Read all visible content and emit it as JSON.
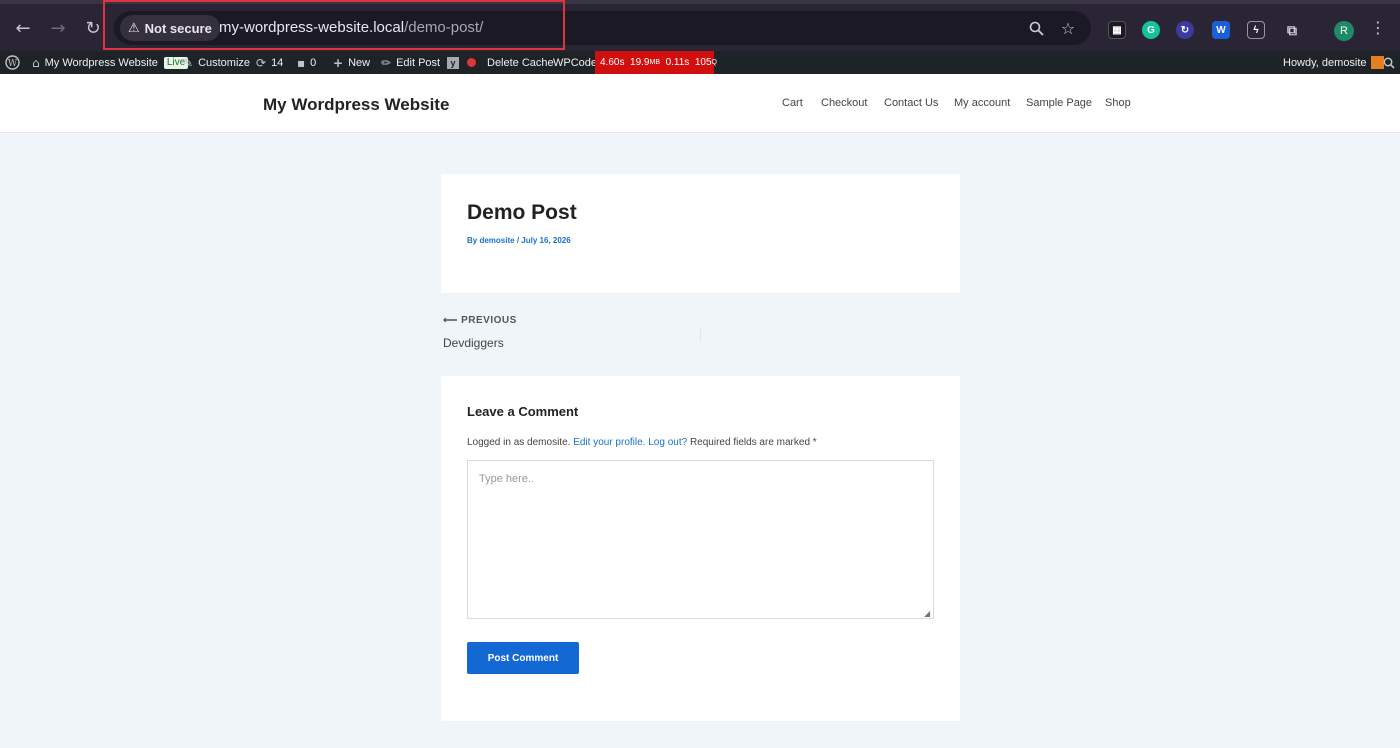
{
  "browser": {
    "security_label": "Not secure",
    "url_host": "my-wordpress-website.local",
    "url_path": "/demo-post/",
    "profile_initial": "R",
    "icons": [
      "back-icon",
      "forward-icon",
      "reload-icon",
      "warning-icon",
      "zoom-icon",
      "star-icon",
      "extensions-icon",
      "menu-icon"
    ]
  },
  "adminbar": {
    "site_name": "My Wordpress Website",
    "live_badge": "Live",
    "customize": "Customize",
    "updates_count": "14",
    "comments_count": "0",
    "new_label": "New",
    "edit_post": "Edit Post",
    "delete_cache": "Delete Cache",
    "wpcode": "WPCode",
    "qm_time": "4.60s",
    "qm_mem": "19.9",
    "qm_mem_unit": "MB",
    "qm_db_time": "0.11s",
    "qm_queries": "105",
    "qm_queries_unit": "Q",
    "howdy": "Howdy, demosite"
  },
  "header": {
    "site_title": "My Wordpress Website",
    "menu": [
      "Cart",
      "Checkout",
      "Contact Us",
      "My account",
      "Sample Page",
      "Shop"
    ]
  },
  "post": {
    "title": "Demo Post",
    "by": "By",
    "author": "demosite",
    "sep": "/",
    "date": "July 16, 2026"
  },
  "navigation": {
    "prev_arrow": "⟵",
    "prev_label": "PREVIOUS",
    "prev_title": "Devdiggers"
  },
  "comment_form": {
    "heading": "Leave a Comment",
    "logged_in_text": "Logged in as demosite.",
    "edit_profile": "Edit your profile.",
    "logout": "Log out?",
    "required_note": "Required fields are marked *",
    "placeholder": "Type here..",
    "submit": "Post Comment"
  },
  "colors": {
    "accent": "#1468d4",
    "link": "#1a73c7",
    "qm_red": "#d10f0f",
    "page_bg": "#f0f5fa"
  }
}
